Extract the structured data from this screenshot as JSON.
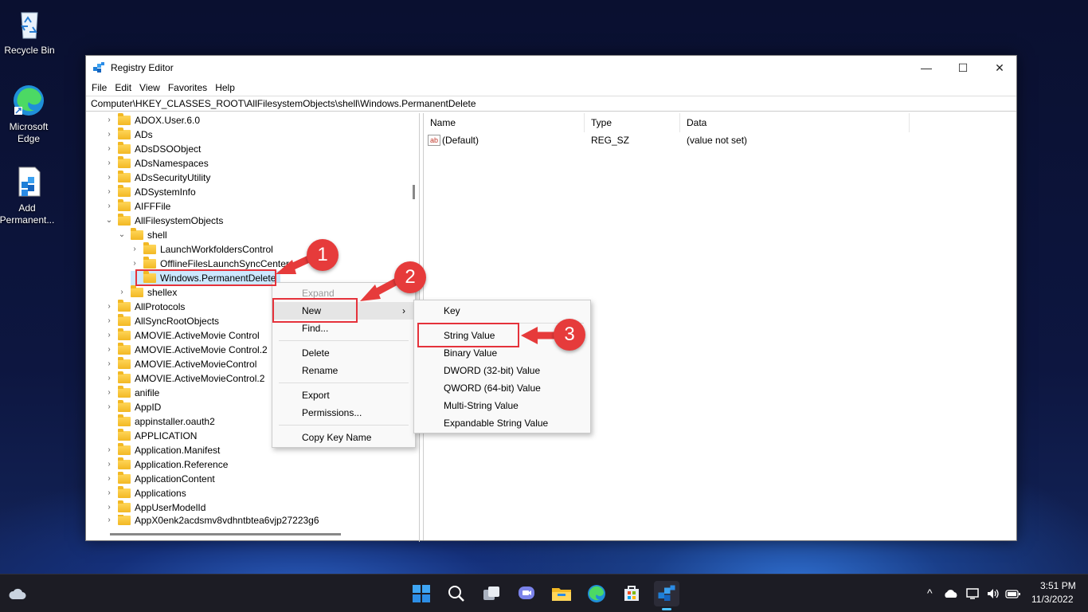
{
  "desktop": {
    "icons": [
      {
        "label": "Recycle Bin"
      },
      {
        "label": "Microsoft Edge"
      },
      {
        "label": "Add Permanent..."
      }
    ]
  },
  "window": {
    "title": "Registry Editor",
    "controls": {
      "minimize": "—",
      "maximize": "☐",
      "close": "✕"
    }
  },
  "menu": {
    "items": [
      "File",
      "Edit",
      "View",
      "Favorites",
      "Help"
    ]
  },
  "address": "Computer\\HKEY_CLASSES_ROOT\\AllFilesystemObjects\\shell\\Windows.PermanentDelete",
  "tree": {
    "rows": [
      {
        "label": "ADOX.User.6.0",
        "expander": "›"
      },
      {
        "label": "ADs",
        "expander": "›"
      },
      {
        "label": "ADsDSOObject",
        "expander": "›"
      },
      {
        "label": "ADsNamespaces",
        "expander": "›"
      },
      {
        "label": "ADsSecurityUtility",
        "expander": "›"
      },
      {
        "label": "ADSystemInfo",
        "expander": "›"
      },
      {
        "label": "AIFFFile",
        "expander": "›"
      },
      {
        "label": "AllFilesystemObjects",
        "expander": "⌄"
      },
      {
        "label": "shell",
        "expander": "⌄"
      },
      {
        "label": "LaunchWorkfoldersControl",
        "expander": "›"
      },
      {
        "label": "OfflineFilesLaunchSyncCenter",
        "expander": "›"
      },
      {
        "label": "Windows.PermanentDelete",
        "expander": ""
      },
      {
        "label": "shellex",
        "expander": "›"
      },
      {
        "label": "AllProtocols",
        "expander": "›"
      },
      {
        "label": "AllSyncRootObjects",
        "expander": "›"
      },
      {
        "label": "AMOVIE.ActiveMovie Control",
        "expander": "›"
      },
      {
        "label": "AMOVIE.ActiveMovie Control.2",
        "expander": "›"
      },
      {
        "label": "AMOVIE.ActiveMovieControl",
        "expander": "›"
      },
      {
        "label": "AMOVIE.ActiveMovieControl.2",
        "expander": "›"
      },
      {
        "label": "anifile",
        "expander": "›"
      },
      {
        "label": "AppID",
        "expander": "›"
      },
      {
        "label": "appinstaller.oauth2",
        "expander": ""
      },
      {
        "label": "APPLICATION",
        "expander": ""
      },
      {
        "label": "Application.Manifest",
        "expander": "›"
      },
      {
        "label": "Application.Reference",
        "expander": "›"
      },
      {
        "label": "ApplicationContent",
        "expander": "›"
      },
      {
        "label": "Applications",
        "expander": "›"
      },
      {
        "label": "AppUserModelId",
        "expander": "›"
      },
      {
        "label": "AppX0enk2acdsmv8vdhntbtea6vjp27223g6",
        "expander": "›"
      }
    ]
  },
  "values": {
    "columns": {
      "name": "Name",
      "type": "Type",
      "data": "Data"
    },
    "rows": [
      {
        "icon": "ab",
        "name": "(Default)",
        "type": "REG_SZ",
        "data": "(value not set)"
      }
    ]
  },
  "context_menu": {
    "expand": "Expand",
    "new": "New",
    "new_arrow": "›",
    "find": "Find...",
    "delete": "Delete",
    "rename": "Rename",
    "export": "Export",
    "permissions": "Permissions...",
    "copy_key_name": "Copy Key Name"
  },
  "submenu": {
    "items": [
      "Key",
      "String Value",
      "Binary Value",
      "DWORD (32-bit) Value",
      "QWORD (64-bit) Value",
      "Multi-String Value",
      "Expandable String Value"
    ]
  },
  "callouts": [
    "1",
    "2",
    "3"
  ],
  "taskbar": {
    "time": "3:51 PM",
    "date": "11/3/2022",
    "tray_chevron": "^"
  },
  "colors": {
    "callout": "#e63b3b",
    "selection": "#cce8ff",
    "taskbar": "#1c1c24"
  }
}
